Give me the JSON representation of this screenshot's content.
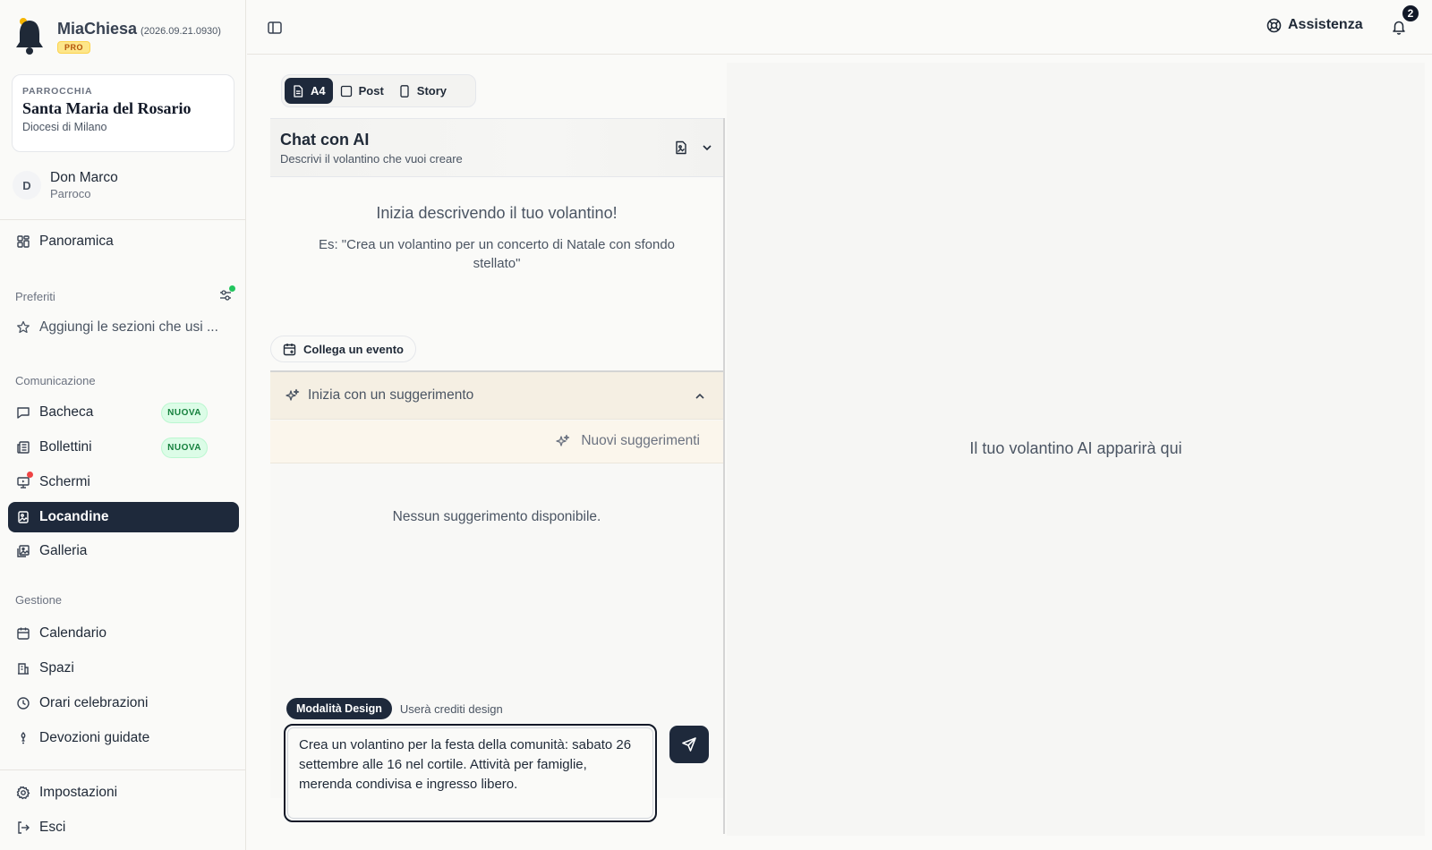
{
  "brand": {
    "name": "MiaChiesa",
    "version": "(2026.09.21.0930)",
    "tier": "PRO"
  },
  "parish": {
    "label": "PARROCCHIA",
    "name": "Santa Maria del Rosario",
    "diocese": "Diocesi di Milano"
  },
  "user": {
    "initial": "D",
    "name": "Don Marco",
    "role": "Parroco"
  },
  "nav": {
    "overview": "Panoramica",
    "favorites": {
      "title": "Preferiti",
      "placeholder": "Aggiungi le sezioni che usi ..."
    },
    "communication": {
      "title": "Comunicazione",
      "items": [
        {
          "label": "Bacheca",
          "badge": "NUOVA"
        },
        {
          "label": "Bollettini",
          "badge": "NUOVA"
        },
        {
          "label": "Schermi"
        },
        {
          "label": "Locandine"
        },
        {
          "label": "Galleria"
        }
      ]
    },
    "management": {
      "title": "Gestione",
      "items": [
        {
          "label": "Calendario"
        },
        {
          "label": "Spazi"
        },
        {
          "label": "Orari celebrazioni"
        },
        {
          "label": "Devozioni guidate"
        }
      ]
    },
    "settings": "Impostazioni",
    "logout": "Esci"
  },
  "topbar": {
    "help": "Assistenza",
    "notifications_count": "2"
  },
  "format_tabs": [
    {
      "label": "A4",
      "active": true
    },
    {
      "label": "Post",
      "active": false
    },
    {
      "label": "Story",
      "active": false
    }
  ],
  "chat": {
    "title": "Chat con AI",
    "subtitle": "Descrivi il volantino che vuoi creare",
    "empty_title": "Inizia descrivendo il tuo volantino!",
    "empty_example": "Es: \"Crea un volantino per un concerto di Natale con sfondo stellato\"",
    "link_event": "Collega un evento",
    "suggestions_title": "Inizia con un suggerimento",
    "new_suggestions": "Nuovi suggerimenti",
    "no_suggestions": "Nessun suggerimento disponibile.",
    "design_mode": "Modalità Design",
    "design_credits": "Userà crediti design",
    "prompt_value": "Crea un volantino per la festa della comunità: sabato 26 settembre alle 16 nel cortile. Attività per famiglie, merenda condivisa e ingresso libero."
  },
  "preview": {
    "placeholder": "Il tuo volantino AI apparirà qui"
  },
  "colors": {
    "accent": "#1e293b",
    "badge_green": "#15803d",
    "pro": "#b45309",
    "notification_dot": "#ef4444"
  }
}
